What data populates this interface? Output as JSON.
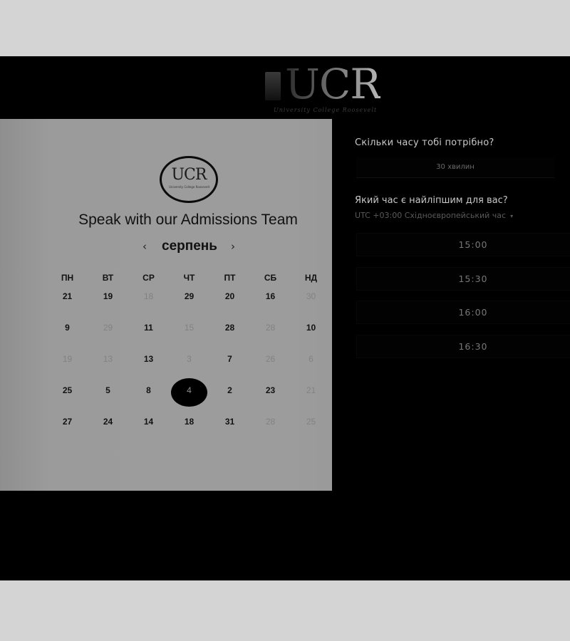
{
  "header": {
    "logo_text": "UCR",
    "logo_tagline": "University College Roosevelt"
  },
  "card": {
    "logo_text": "UCR",
    "logo_small": "University College Roosevelt",
    "title": "Speak with our Admissions Team",
    "month": "серпень",
    "prev_icon": "chevron-left-icon",
    "next_icon": "chevron-right-icon",
    "weekdays": [
      "ПН",
      "ВТ",
      "СР",
      "ЧТ",
      "ПТ",
      "СБ",
      "НД"
    ],
    "weeks": [
      [
        {
          "d": "21",
          "on": true
        },
        {
          "d": "19",
          "on": true
        },
        {
          "d": "18",
          "on": false
        },
        {
          "d": "29",
          "on": true
        },
        {
          "d": "20",
          "on": true
        },
        {
          "d": "16",
          "on": true
        },
        {
          "d": "30",
          "on": false
        }
      ],
      [
        {
          "d": "9",
          "on": true
        },
        {
          "d": "29",
          "on": false
        },
        {
          "d": "11",
          "on": true
        },
        {
          "d": "15",
          "on": false
        },
        {
          "d": "28",
          "on": true
        },
        {
          "d": "28",
          "on": false
        },
        {
          "d": "10",
          "on": true
        }
      ],
      [
        {
          "d": "19",
          "on": false
        },
        {
          "d": "13",
          "on": false
        },
        {
          "d": "13",
          "on": true
        },
        {
          "d": "3",
          "on": false
        },
        {
          "d": "7",
          "on": true
        },
        {
          "d": "26",
          "on": false
        },
        {
          "d": "6",
          "on": false
        }
      ],
      [
        {
          "d": "25",
          "on": true
        },
        {
          "d": "5",
          "on": true
        },
        {
          "d": "8",
          "on": true
        },
        {
          "d": "4",
          "on": true,
          "selected": true
        },
        {
          "d": "2",
          "on": true
        },
        {
          "d": "23",
          "on": true
        },
        {
          "d": "21",
          "on": false
        }
      ],
      [
        {
          "d": "27",
          "on": true
        },
        {
          "d": "24",
          "on": true
        },
        {
          "d": "14",
          "on": true
        },
        {
          "d": "18",
          "on": true
        },
        {
          "d": "31",
          "on": true
        },
        {
          "d": "28",
          "on": false
        },
        {
          "d": "25",
          "on": false
        }
      ]
    ]
  },
  "panel": {
    "duration_question": "Скільки часу тобі потрібно?",
    "duration_value": "30 хвилин",
    "time_question": "Який час є найліпшим для вас?",
    "timezone": "UTC +03:00 Східноєвропейський час",
    "timezone_caret": "▾",
    "slots": [
      "15:00",
      "15:30",
      "16:00",
      "16:30"
    ]
  },
  "colors": {
    "background": "#000000",
    "card": "#9b9b9b",
    "selected_day": "#000000"
  }
}
